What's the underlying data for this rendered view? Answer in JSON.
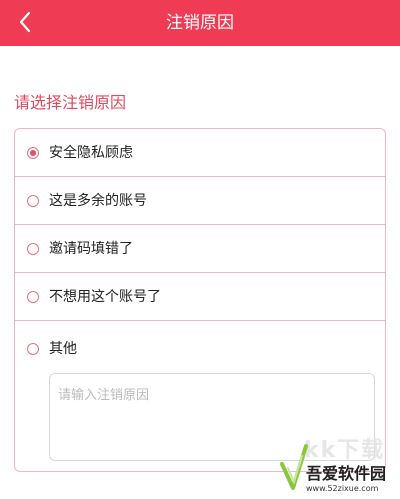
{
  "header": {
    "title": "注销原因",
    "back_icon": "chevron-left-icon",
    "bg_color": "#f03b55"
  },
  "section": {
    "label": "请选择注销原因"
  },
  "options": [
    {
      "label": "安全隐私顾虑",
      "checked": true
    },
    {
      "label": "这是多余的账号",
      "checked": false
    },
    {
      "label": "邀请码填错了",
      "checked": false
    },
    {
      "label": "不想用这个账号了",
      "checked": false
    },
    {
      "label": "其他",
      "checked": false
    }
  ],
  "textarea": {
    "placeholder": "请输入注销原因",
    "value": ""
  },
  "colors": {
    "accent": "#f03b55",
    "border": "#f0b7c0",
    "section_text": "#e04a60"
  },
  "watermark": {
    "faint_text": "kk下载",
    "text": "吾爱软件园",
    "url": "www.52zixue.com"
  }
}
